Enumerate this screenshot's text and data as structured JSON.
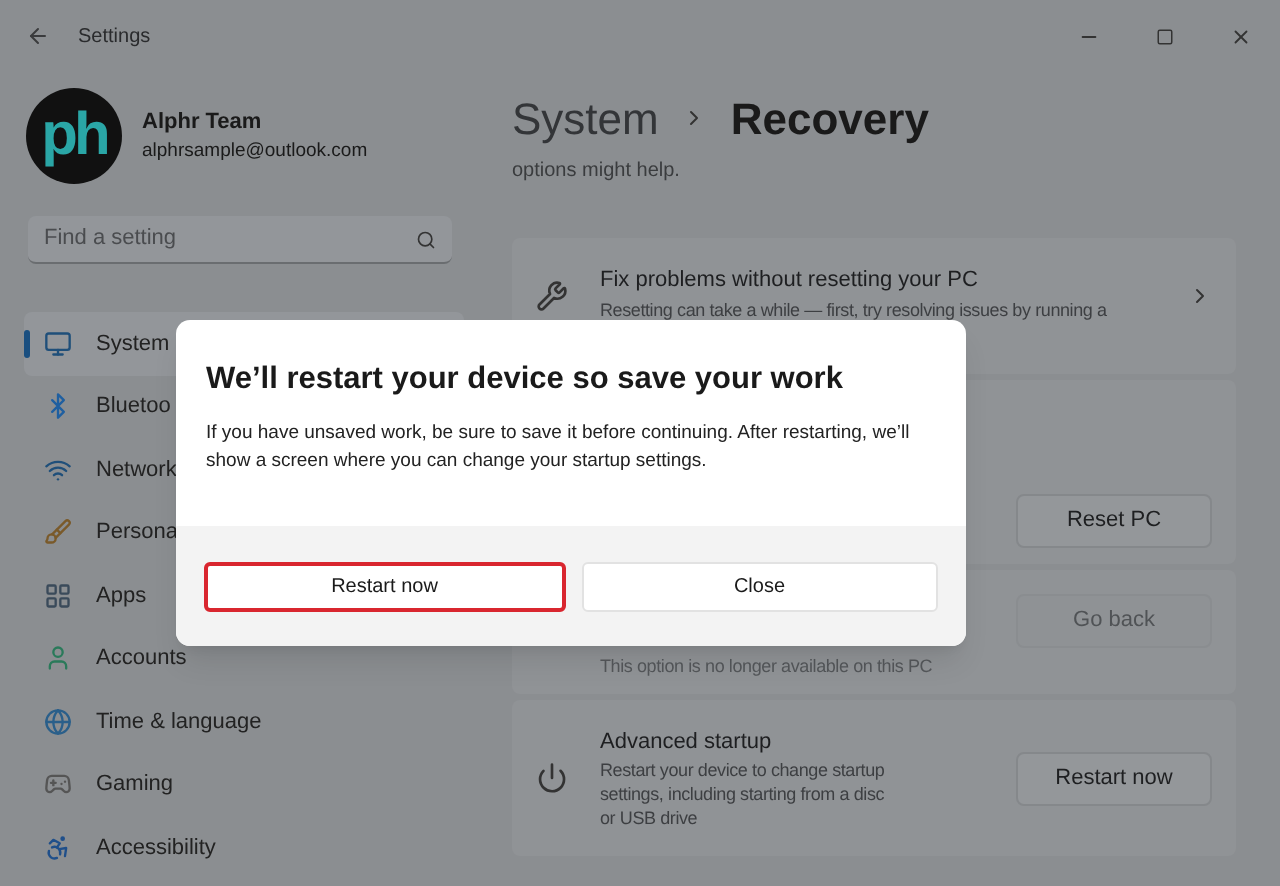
{
  "window": {
    "title": "Settings"
  },
  "profile": {
    "name": "Alphr Team",
    "email": "alphrsample@outlook.com",
    "avatar_text": "ph"
  },
  "search": {
    "placeholder": "Find a setting"
  },
  "nav": [
    {
      "label": "System",
      "selected": true
    },
    {
      "label": "Bluetoo",
      "selected": false
    },
    {
      "label": "Network",
      "selected": false
    },
    {
      "label": "Persona",
      "selected": false
    },
    {
      "label": "Apps",
      "selected": false
    },
    {
      "label": "Accounts",
      "selected": false
    },
    {
      "label": "Time & language",
      "selected": false
    },
    {
      "label": "Gaming",
      "selected": false
    },
    {
      "label": "Accessibility",
      "selected": false
    }
  ],
  "breadcrumb": {
    "parent": "System",
    "current": "Recovery"
  },
  "intro": "options might help.",
  "cards": [
    {
      "kind": "link",
      "title": "Fix problems without resetting your PC",
      "description": "Resetting can take a while — first, try resolving issues by running a"
    },
    {
      "kind": "button",
      "button": "Reset PC",
      "disabled": false
    },
    {
      "kind": "button",
      "description": "This option is no longer available on this PC",
      "button": "Go back",
      "disabled": true
    },
    {
      "kind": "button",
      "title": "Advanced startup",
      "description": "Restart your device to change startup settings, including starting from a disc or USB drive",
      "button": "Restart now",
      "disabled": false
    }
  ],
  "dialog": {
    "title": "We’ll restart your device so save your work",
    "body": "If you have unsaved work, be sure to save it before continuing. After restarting, we’ll show a screen where you can change your startup settings.",
    "buttons": [
      {
        "label": "Restart now",
        "highlighted": true
      },
      {
        "label": "Close",
        "highlighted": false
      }
    ]
  }
}
